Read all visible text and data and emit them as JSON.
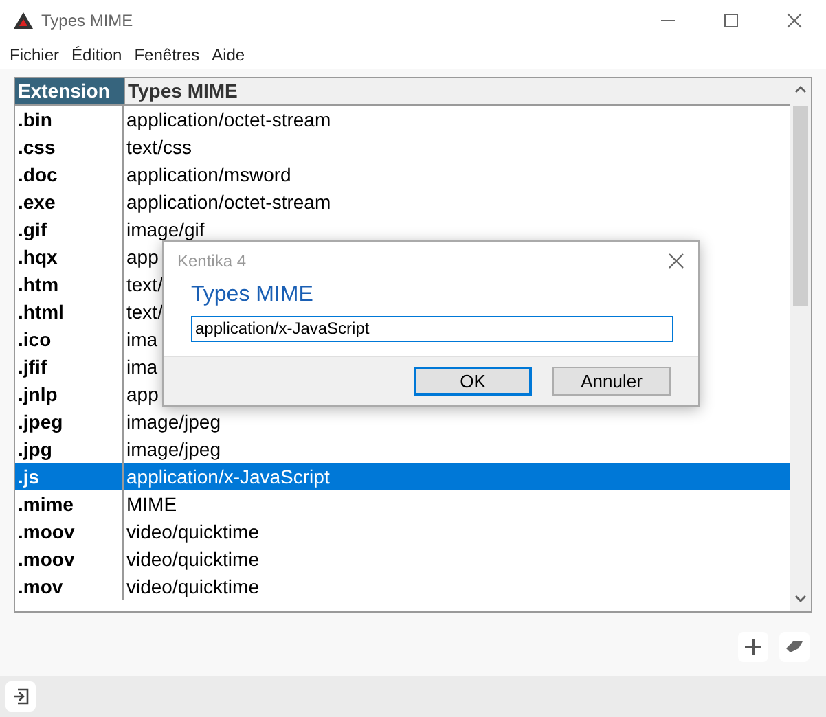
{
  "window": {
    "title": "Types MIME"
  },
  "menu": [
    "Fichier",
    "Édition",
    "Fenêtres",
    "Aide"
  ],
  "table": {
    "columns": [
      "Extension",
      "Types MIME"
    ],
    "rows": [
      {
        "extension": ".bin",
        "mime": "application/octet-stream",
        "selected": false
      },
      {
        "extension": ".css",
        "mime": "text/css",
        "selected": false
      },
      {
        "extension": ".doc",
        "mime": "application/msword",
        "selected": false
      },
      {
        "extension": ".exe",
        "mime": "application/octet-stream",
        "selected": false
      },
      {
        "extension": ".gif",
        "mime": "image/gif",
        "selected": false
      },
      {
        "extension": ".hqx",
        "mime": "app",
        "selected": false
      },
      {
        "extension": ".htm",
        "mime": "text/",
        "selected": false
      },
      {
        "extension": ".html",
        "mime": "text/",
        "selected": false
      },
      {
        "extension": ".ico",
        "mime": "ima",
        "selected": false
      },
      {
        "extension": ".jfif",
        "mime": "ima",
        "selected": false
      },
      {
        "extension": ".jnlp",
        "mime": "app",
        "selected": false
      },
      {
        "extension": ".jpeg",
        "mime": "image/jpeg",
        "selected": false
      },
      {
        "extension": ".jpg",
        "mime": "image/jpeg",
        "selected": false
      },
      {
        "extension": ".js",
        "mime": "application/x-JavaScript",
        "selected": true
      },
      {
        "extension": ".mime",
        "mime": "MIME",
        "selected": false
      },
      {
        "extension": ".moov",
        "mime": "video/quicktime",
        "selected": false
      },
      {
        "extension": ".moov",
        "mime": "video/quicktime",
        "selected": false
      },
      {
        "extension": ".mov",
        "mime": "video/quicktime",
        "selected": false
      }
    ]
  },
  "dialog": {
    "title": "Kentika 4",
    "heading": "Types MIME",
    "value": "application/x-JavaScript",
    "buttons": [
      {
        "label": "OK",
        "default": true
      },
      {
        "label": "Annuler",
        "default": false
      }
    ]
  }
}
